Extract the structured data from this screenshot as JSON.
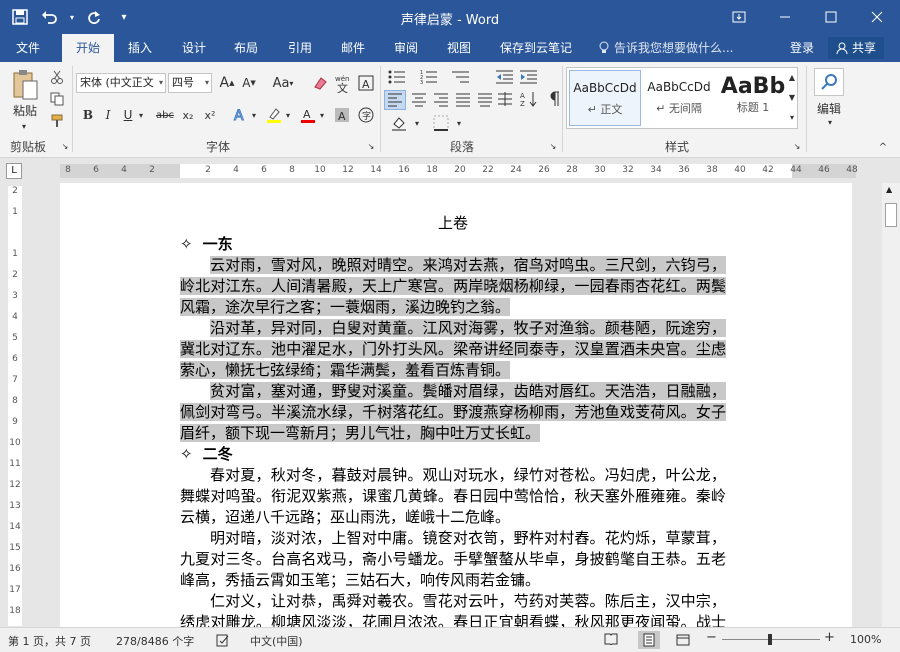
{
  "window": {
    "title": "声律启蒙 - Word",
    "controls": [
      "restore-ribbon-icon",
      "minimize-icon",
      "maximize-icon",
      "close-icon"
    ]
  },
  "qat": {
    "save": "save-icon",
    "undo": "undo-icon",
    "redo": "redo-icon",
    "customize": "customize-icon"
  },
  "tabs": [
    "文件",
    "开始",
    "插入",
    "设计",
    "布局",
    "引用",
    "邮件",
    "审阅",
    "视图",
    "保存到云笔记"
  ],
  "active_tab": "开始",
  "tellme": "告诉我您想要做什么...",
  "login": "登录",
  "share": "共享",
  "ribbon": {
    "clipboard": {
      "paste": "粘贴",
      "label": "剪贴板"
    },
    "font": {
      "name": "宋体 (中文正文",
      "size": "四号",
      "label": "字体",
      "grow": "A",
      "shrink": "A",
      "case": "Aa",
      "bold": "B",
      "italic": "I",
      "underline": "U",
      "strike": "abc",
      "sub": "x₂",
      "sup": "x²"
    },
    "paragraph": {
      "label": "段落"
    },
    "styles": {
      "label": "样式",
      "items": [
        {
          "sample": "AaBbCcDd",
          "name": "↵ 正文"
        },
        {
          "sample": "AaBbCcDd",
          "name": "↵ 无间隔"
        },
        {
          "sample": "AaBb",
          "name": "标题 1"
        }
      ]
    },
    "editing": {
      "label": "编辑"
    }
  },
  "ruler": {
    "ticks": [
      "8",
      "6",
      "4",
      "2",
      "",
      "2",
      "4",
      "6",
      "8",
      "10",
      "12",
      "14",
      "16",
      "18",
      "20",
      "22",
      "24",
      "26",
      "28",
      "30",
      "32",
      "34",
      "36",
      "38",
      "40",
      "42",
      "44",
      "46",
      "48"
    ]
  },
  "vruler": {
    "ticks": [
      "2",
      "1",
      "",
      "1",
      "2",
      "3",
      "4",
      "5",
      "6",
      "7",
      "8",
      "9",
      "10",
      "11",
      "12",
      "13",
      "14",
      "15",
      "16",
      "17",
      "18",
      "19"
    ]
  },
  "document": {
    "title": "上卷",
    "sections": [
      {
        "heading": "一东",
        "highlighted": true,
        "paragraphs": [
          "云对雨，雪对风，晚照对晴空。来鸿对去燕，宿鸟对鸣虫。三尺剑，六钧弓，岭北对江东。人间清暑殿，天上广寒宫。两岸晓烟杨柳绿，一园春雨杏花红。两鬓风霜，途次早行之客；一蓑烟雨，溪边晚钓之翁。",
          "沿对革，异对同，白叟对黄童。江风对海雾，牧子对渔翁。颜巷陋，阮途穷，冀北对辽东。池中濯足水，门外打头风。梁帝讲经同泰寺，汉皇置酒未央宫。尘虑萦心，懒抚七弦绿绮；霜华满鬓，羞看百炼青铜。",
          "贫对富，塞对通，野叟对溪童。鬓皤对眉绿，齿皓对唇红。天浩浩，日融融，佩剑对弯弓。半溪流水绿，千树落花红。野渡燕穿杨柳雨，芳池鱼戏芰荷风。女子眉纤，额下现一弯新月；男儿气壮，胸中吐万丈长虹。"
        ]
      },
      {
        "heading": "二冬",
        "highlighted": false,
        "paragraphs": [
          "春对夏，秋对冬，暮鼓对晨钟。观山对玩水，绿竹对苍松。冯妇虎，叶公龙，舞蝶对鸣蛩。衔泥双紫燕，课蜜几黄蜂。春日园中莺恰恰，秋天塞外雁雍雍。秦岭云横，迢递八千远路；巫山雨洗，嵯峨十二危峰。",
          "明对暗，淡对浓，上智对中庸。镜奁对衣笥，野杵对村舂。花灼烁，草蒙茸，九夏对三冬。台高名戏马，斋小号蟠龙。手擘蟹螯从毕卓，身披鹤氅自王恭。五老峰高，秀插云霄如玉笔；三姑石大，响传风雨若金镛。",
          "仁对义，让对恭，禹舜对羲农。雪花对云叶，芍药对芙蓉。陈后主，汉中宗，绣虎对雕龙。柳塘风淡淡，花圃月浓浓。春日正宜朝看蝶，秋风那更夜闻蛩。战士邀功，必借干戈成勇武；逸民适志，须凭诗酒养疏慵。"
        ]
      }
    ]
  },
  "status": {
    "page": "第 1 页，共 7 页",
    "words": "278/8486 个字",
    "proof_icon": "proofing-icon",
    "language": "中文(中国)",
    "zoom": "100%",
    "zoom_minus": "−",
    "zoom_plus": "+"
  }
}
